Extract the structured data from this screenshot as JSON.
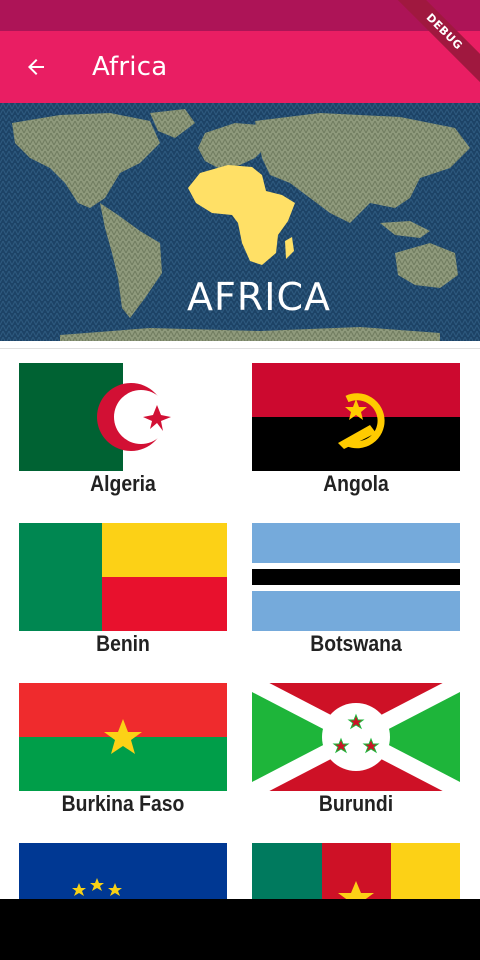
{
  "app_bar": {
    "title": "Africa"
  },
  "debug_banner": {
    "label": "DEBUG"
  },
  "banner": {
    "caption": "AFRICA"
  },
  "countries": [
    {
      "name": "Algeria"
    },
    {
      "name": "Angola"
    },
    {
      "name": "Benin"
    },
    {
      "name": "Botswana"
    },
    {
      "name": "Burkina Faso"
    },
    {
      "name": "Burundi"
    },
    {
      "name": ""
    },
    {
      "name": ""
    }
  ],
  "colors": {
    "status_bar": "#ad1457",
    "app_bar": "#e91e63",
    "map_ocean": "#1d4366",
    "africa": "#ffe066"
  }
}
